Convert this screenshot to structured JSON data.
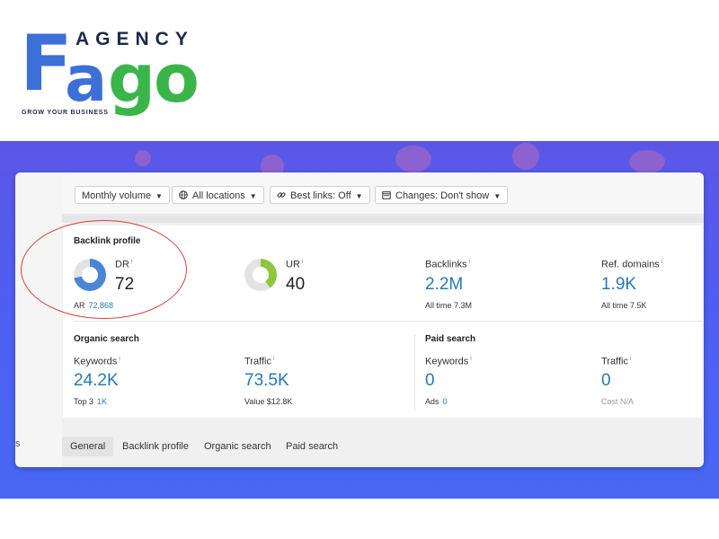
{
  "logo": {
    "wordmark_f": "F",
    "wordmark_a": "a",
    "wordmark_go": "go",
    "agency": "AGENCY",
    "tagline": "GROW YOUR BUSINESS",
    "colors": {
      "blue": "#3d6fd9",
      "green": "#3ab54a",
      "dark": "#1c2a4a"
    }
  },
  "filters": [
    {
      "label": "Monthly volume",
      "icon": "none",
      "has_caret": true
    },
    {
      "label": "All locations",
      "icon": "globe-icon",
      "has_caret": true
    },
    {
      "label": "Best links: Off",
      "icon": "link-icon",
      "has_caret": true
    },
    {
      "label": "Changes: Don't show",
      "icon": "calendar-icon",
      "has_caret": true
    }
  ],
  "backlink_profile": {
    "title": "Backlink profile",
    "dr": {
      "label": "DR",
      "info": "i",
      "value": "72",
      "sub_label": "AR",
      "sub_value": "72,868",
      "donut_fill": 0.72,
      "donut_color": "#4a86d4"
    },
    "ur": {
      "label": "UR",
      "info": "i",
      "value": "40",
      "donut_fill": 0.4,
      "donut_color": "#8dc63f"
    },
    "backlinks": {
      "label": "Backlinks",
      "info": "i",
      "value": "2.2M",
      "sub": "All time 7.3M"
    },
    "ref_domains": {
      "label": "Ref. domains",
      "info": "i",
      "value": "1.9K",
      "sub": "All time 7.5K"
    }
  },
  "organic_search": {
    "title": "Organic search",
    "keywords": {
      "label": "Keywords",
      "info": "i",
      "value": "24.2K",
      "sub_label": "Top 3",
      "sub_value": "1K"
    },
    "traffic": {
      "label": "Traffic",
      "info": "i",
      "value": "73.5K",
      "sub": "Value $12.8K"
    }
  },
  "paid_search": {
    "title": "Paid search",
    "keywords": {
      "label": "Keywords",
      "info": "i",
      "value": "0",
      "sub_label": "Ads",
      "sub_value": "0"
    },
    "traffic": {
      "label": "Traffic",
      "info": "i",
      "value": "0",
      "sub": "Cost N/A"
    }
  },
  "tabs": [
    {
      "label": "General",
      "active": true
    },
    {
      "label": "Backlink profile",
      "active": false
    },
    {
      "label": "Organic search",
      "active": false
    },
    {
      "label": "Paid search",
      "active": false
    }
  ],
  "edge_fragment": "s",
  "colors": {
    "accent_blue": "#2679b5",
    "banner": "#4f5ef2",
    "highlight_circle": "#d9423a"
  }
}
